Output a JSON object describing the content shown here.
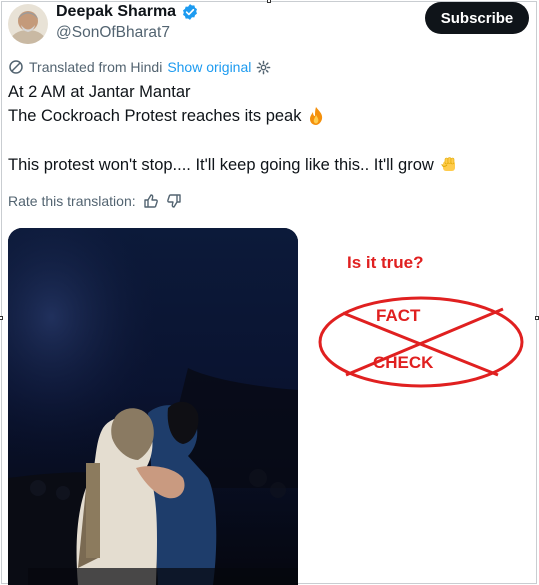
{
  "author": {
    "name": "Deepak Sharma",
    "handle": "@SonOfBharat7",
    "verified_color": "#1d9bf0"
  },
  "actions": {
    "subscribe_label": "Subscribe"
  },
  "translation": {
    "label": "Translated from Hindi",
    "show_original": "Show original",
    "rate_label": "Rate this translation:"
  },
  "tweet": {
    "line1": "At 2 AM at Jantar Mantar",
    "line2": "The Cockroach Protest reaches its peak",
    "line2_emoji": "fire-emoji",
    "line3": "This protest won't stop.... It'll keep going like this.. It'll grow",
    "line3_emoji": "raised-fist-emoji"
  },
  "overlay": {
    "question": "Is it true?",
    "fact": "FACT",
    "check": "CHECK",
    "color": "#e02020"
  }
}
